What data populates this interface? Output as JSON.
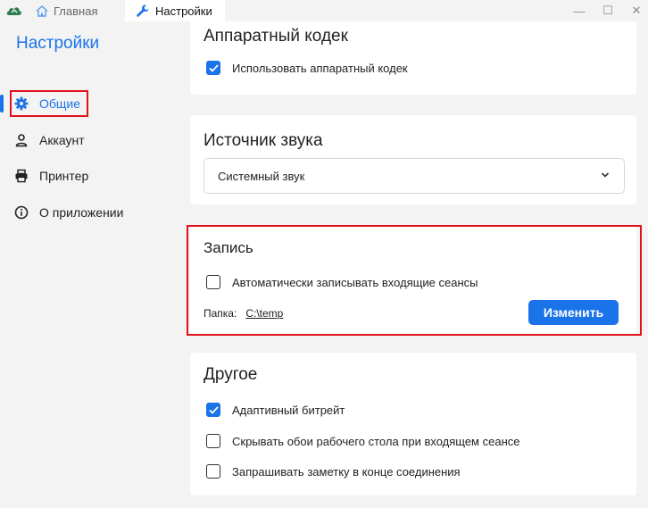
{
  "titlebar": {
    "tabs": [
      {
        "label": "Главная",
        "icon": "home-icon"
      },
      {
        "label": "Настройки",
        "icon": "wrench-icon"
      }
    ],
    "controls": {
      "minimize": "—",
      "maximize": "☐",
      "close": "✕"
    }
  },
  "sidebar": {
    "title": "Настройки",
    "items": [
      {
        "label": "Общие",
        "icon": "gear-icon",
        "active": true
      },
      {
        "label": "Аккаунт",
        "icon": "user-icon"
      },
      {
        "label": "Принтер",
        "icon": "printer-icon"
      },
      {
        "label": "О приложении",
        "icon": "info-icon"
      }
    ]
  },
  "main": {
    "hardware_codec": {
      "title": "Аппаратный кодек",
      "use_hw_codec": {
        "label": "Использовать аппаратный кодек",
        "checked": true
      }
    },
    "audio_source": {
      "title": "Источник звука",
      "selected": "Системный звук"
    },
    "recording": {
      "title": "Запись",
      "auto_record": {
        "label": "Автоматически записывать входящие сеансы",
        "checked": false
      },
      "folder_label": "Папка:",
      "folder_path": "C:\\temp",
      "change_button": "Изменить"
    },
    "other": {
      "title": "Другое",
      "adaptive_bitrate": {
        "label": "Адаптивный битрейт",
        "checked": true
      },
      "hide_wallpaper": {
        "label": "Скрывать обои рабочего стола при входящем сеансе",
        "checked": false
      },
      "ask_note": {
        "label": "Запрашивать заметку в конце соединения",
        "checked": false
      }
    }
  },
  "colors": {
    "accent": "#1a73e8",
    "highlight_red": "#e0121b",
    "background": "#f3f3f3",
    "card": "#ffffff"
  }
}
